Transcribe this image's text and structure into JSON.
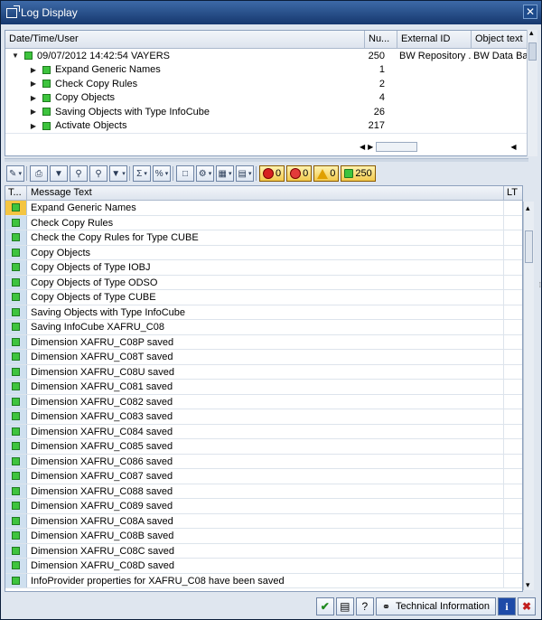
{
  "window": {
    "title": "Log Display",
    "close_glyph": "✕"
  },
  "tree": {
    "columns": [
      "Date/Time/User",
      "Nu...",
      "External ID",
      "Object text"
    ],
    "rows": [
      {
        "expanded": true,
        "date": "09/07/2012  14:42:54  VAYERS",
        "num": "250",
        "ext": "BW Repository ...",
        "obj": "BW Data Bas"
      },
      {
        "expanded": false,
        "date": "Expand Generic Names",
        "num": "1",
        "ext": "",
        "obj": ""
      },
      {
        "expanded": false,
        "date": "Check Copy Rules",
        "num": "2",
        "ext": "",
        "obj": ""
      },
      {
        "expanded": false,
        "date": "Copy Objects",
        "num": "4",
        "ext": "",
        "obj": ""
      },
      {
        "expanded": false,
        "date": "Saving Objects with Type InfoCube",
        "num": "26",
        "ext": "",
        "obj": ""
      },
      {
        "expanded": false,
        "date": "Activate Objects",
        "num": "217",
        "ext": "",
        "obj": ""
      }
    ]
  },
  "toolbar": {
    "counters": {
      "stop": "0",
      "error": "0",
      "warning": "0",
      "success": "250"
    }
  },
  "grid": {
    "columns": {
      "type": "T...",
      "text": "Message Text",
      "lt": "LT"
    },
    "rows": [
      "Expand Generic Names",
      "Check Copy Rules",
      "Check the Copy Rules for Type CUBE",
      "Copy Objects",
      "Copy Objects of Type IOBJ",
      "Copy Objects of Type ODSO",
      "Copy Objects of Type CUBE",
      "Saving Objects with Type InfoCube",
      "Saving InfoCube XAFRU_C08",
      "Dimension XAFRU_C08P saved",
      "Dimension XAFRU_C08T saved",
      "Dimension XAFRU_C08U saved",
      "Dimension XAFRU_C081 saved",
      "Dimension XAFRU_C082 saved",
      "Dimension XAFRU_C083 saved",
      "Dimension XAFRU_C084 saved",
      "Dimension XAFRU_C085 saved",
      "Dimension XAFRU_C086 saved",
      "Dimension XAFRU_C087 saved",
      "Dimension XAFRU_C088 saved",
      "Dimension XAFRU_C089 saved",
      "Dimension XAFRU_C08A saved",
      "Dimension XAFRU_C08B saved",
      "Dimension XAFRU_C08C saved",
      "Dimension XAFRU_C08D saved",
      "InfoProvider properties for XAFRU_C08 have been saved"
    ]
  },
  "footer": {
    "tech_label": "Technical Information"
  },
  "colors": {
    "title_bar": "#16386e",
    "success": "#3ec43e",
    "selected_row": "#f4c542"
  }
}
